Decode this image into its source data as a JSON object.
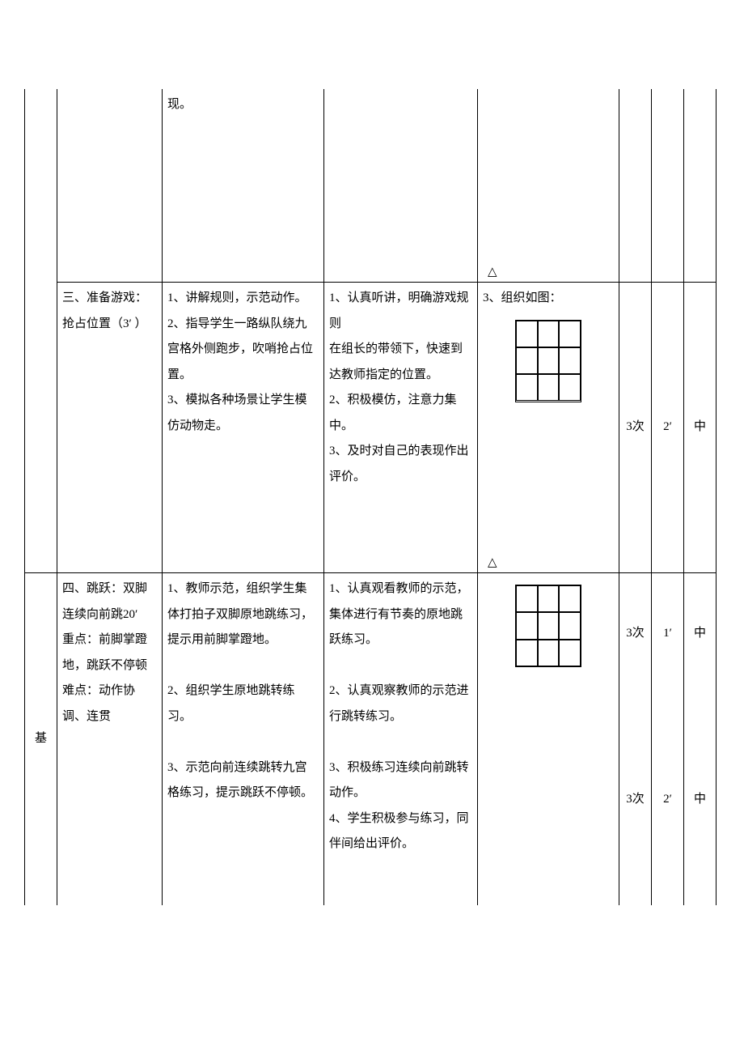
{
  "row1": {
    "c2": "现。"
  },
  "row2": {
    "c1": "三、准备游戏：抢占位置（3′ ）",
    "c2": "1、讲解规则，示范动作。\n2、指导学生一路纵队绕九宫格外侧跑步，吹哨抢占位置。\n3、模拟各种场景让学生模仿动物走。",
    "c3": "1、认真听讲，明确游戏规则\n在组长的带领下，快速到达教师指定的位置。\n2、积极模仿，注意力集中。\n3、及时对自己的表现作出评价。",
    "c4head": "3、组织如图：",
    "c5": "3次",
    "c6": "2′",
    "c7": "中"
  },
  "row3": {
    "side": "基",
    "c1": "四、跳跃：双脚连续向前跳20′\n重点：前脚掌蹬地，跳跃不停顿难点：动作协调、连贯",
    "c2": "1、教师示范，组织学生集体打拍子双脚原地跳练习，提示用前脚掌蹬地。\n\n2、组织学生原地跳转练习。\n\n3、示范向前连续跳转九宫格练习，提示跳跃不停顿。",
    "c3": "1、认真观看教师的示范，集体进行有节奏的原地跳跃练习。\n\n2、认真观察教师的示范进行跳转练习。\n\n3、积极练习连续向前跳转动作。\n4、学生积极参与练习，同伴间给出评价。",
    "c5a": "3次",
    "c6a": "1′",
    "c7a": "中",
    "c5b": "3次",
    "c6b": "2′",
    "c7b": "中"
  }
}
